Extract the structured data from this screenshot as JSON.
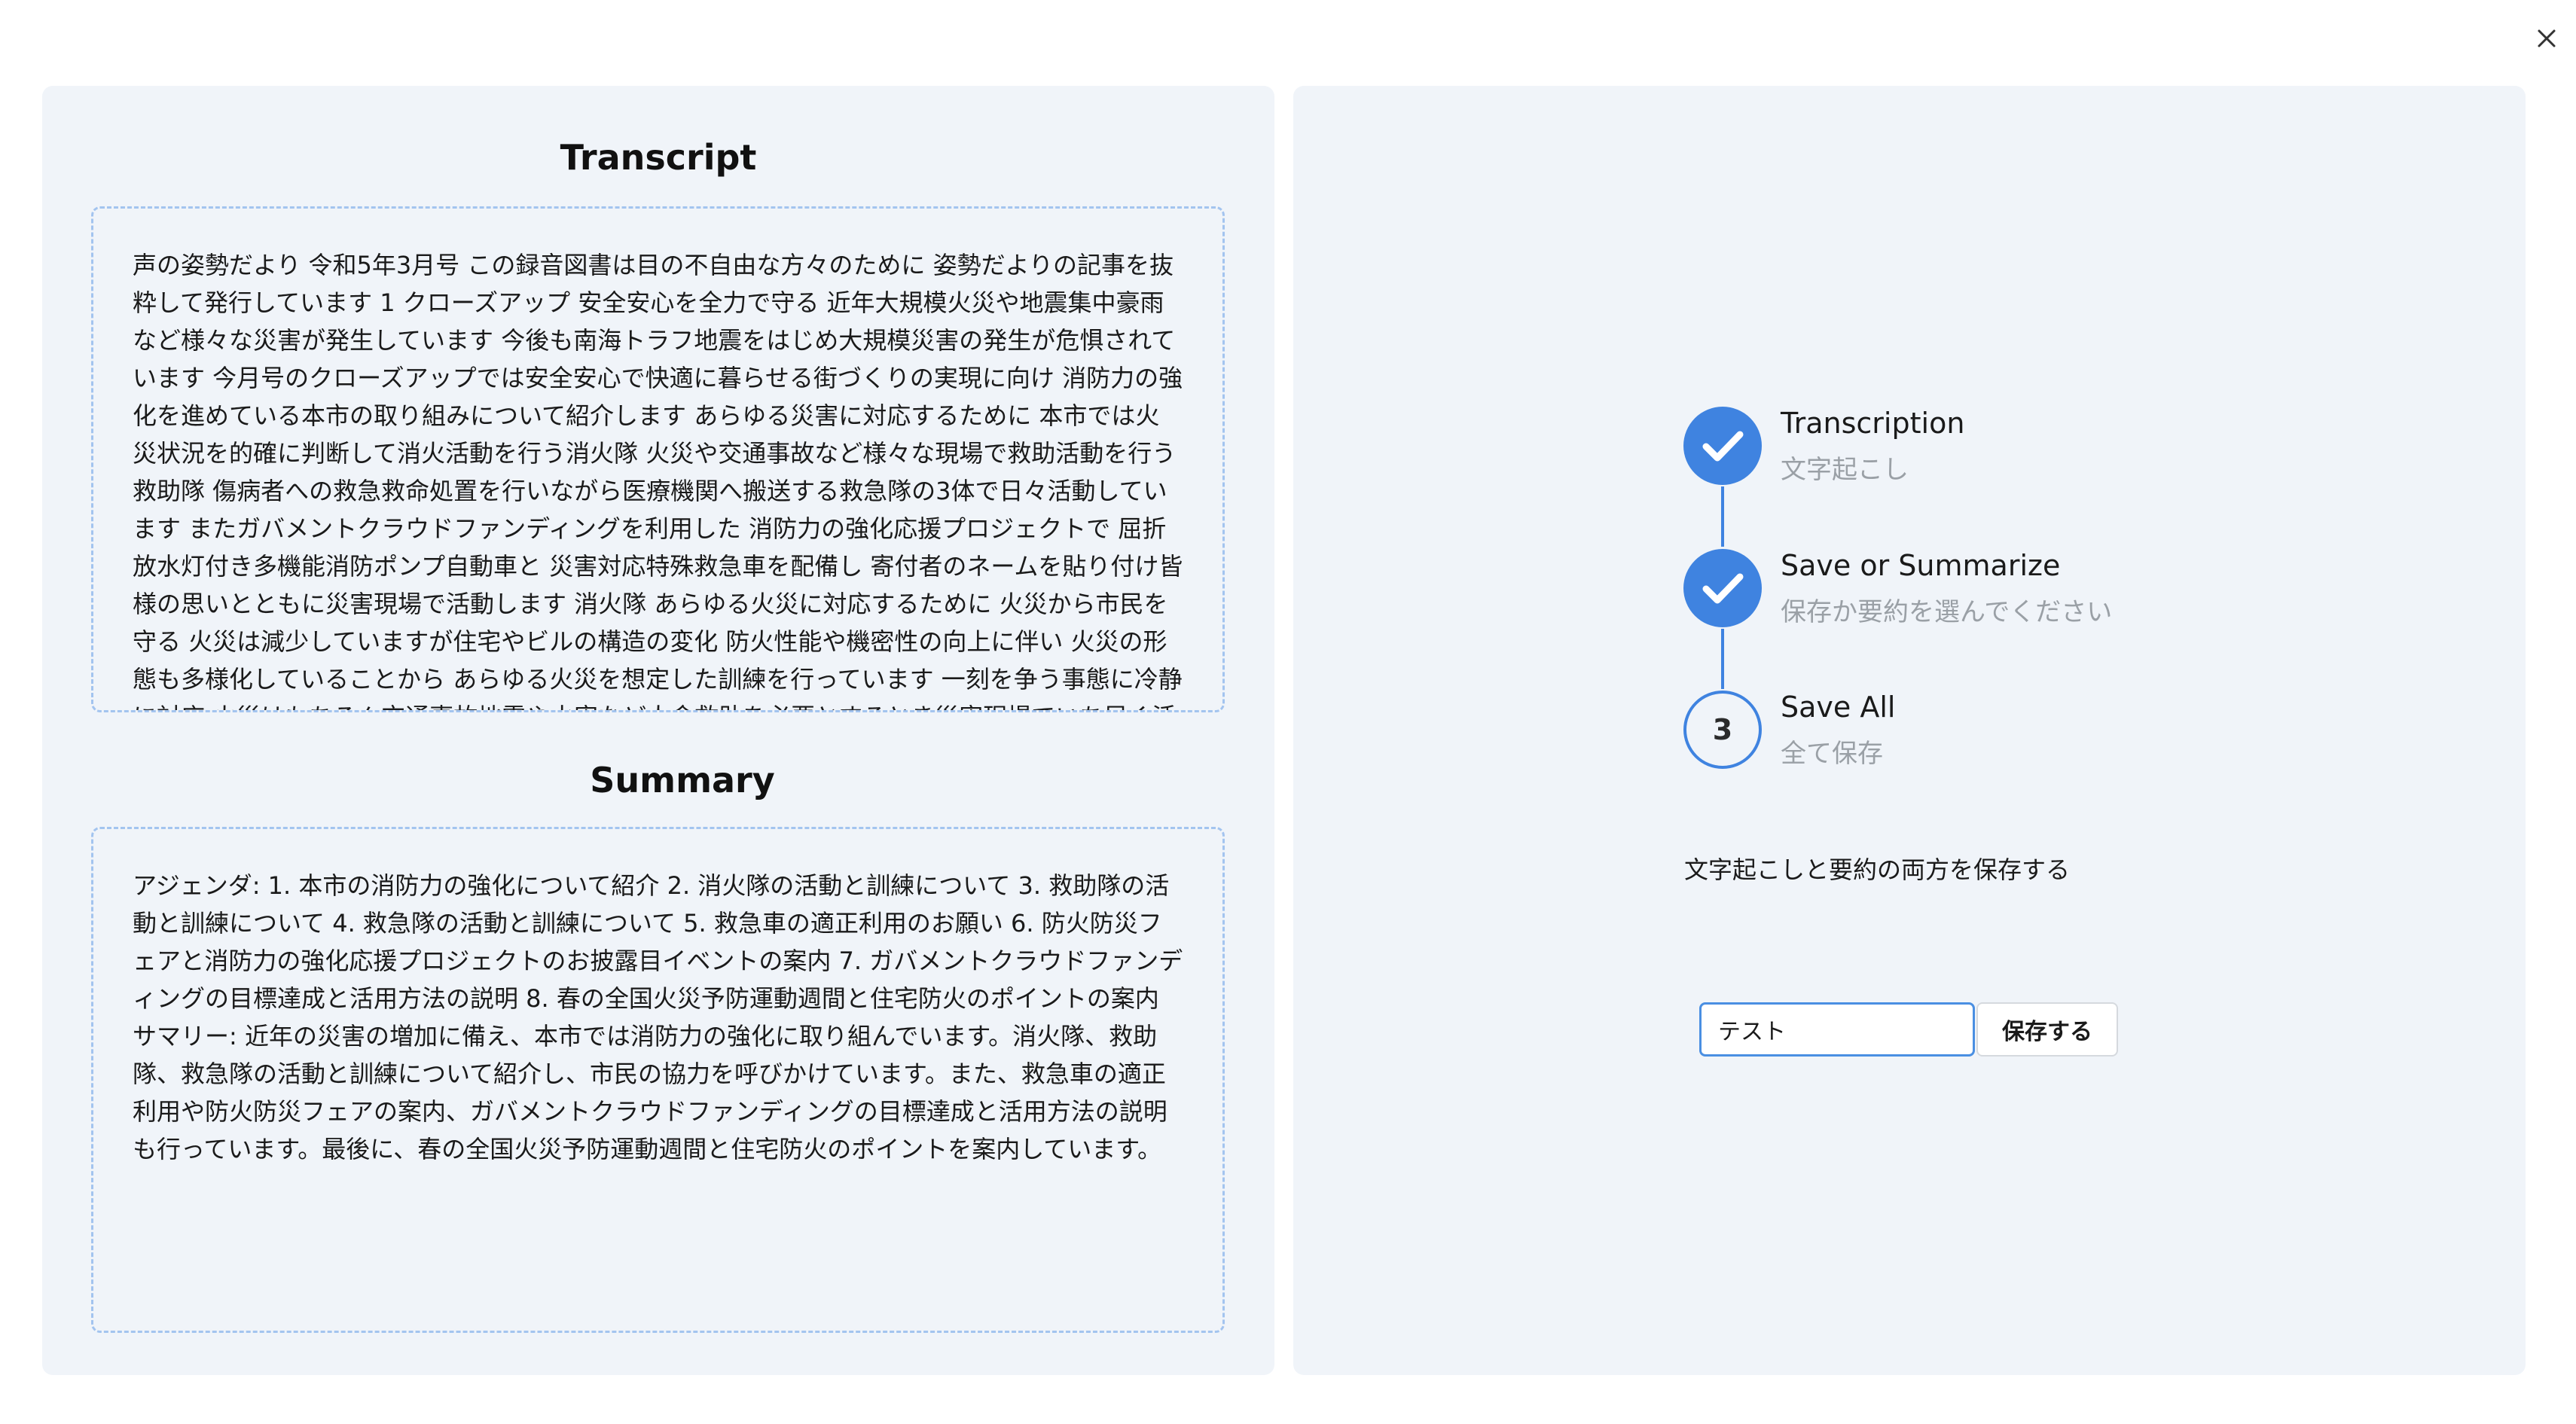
{
  "colors": {
    "accent": "#3f83e0",
    "panel_background": "#f0f4f9",
    "dashed_border": "#a3c4ef",
    "muted_text": "#9aa0a6"
  },
  "window": {
    "close_icon": "close-icon"
  },
  "transcript": {
    "title": "Transcript",
    "text": "声の姿勢だより 令和5年3月号 この録音図書は目の不自由な方々のために 姿勢だよりの記事を抜粋して発行しています 1 クローズアップ 安全安心を全力で守る 近年大規模火災や地震集中豪雨など様々な災害が発生しています 今後も南海トラフ地震をはじめ大規模災害の発生が危惧されています 今月号のクローズアップでは安全安心で快適に暮らせる街づくりの実現に向け 消防力の強化を進めている本市の取り組みについて紹介します あらゆる災害に対応するために 本市では火災状況を的確に判断して消火活動を行う消火隊 火災や交通事故など様々な現場で救助活動を行う救助隊 傷病者への救急救命処置を行いながら医療機関へ搬送する救急隊の3体で日々活動しています またガバメントクラウドファンディングを利用した 消防力の強化応援プロジェクトで 屈折放水灯付き多機能消防ポンプ自動車と 災害対応特殊救急車を配備し 寄付者のネームを貼り付け皆様の思いとともに災害現場で活動します 消火隊 あらゆる火災に対応するために 火災から市民を守る 火災は減少していますが住宅やビルの構造の変化 防火性能や機密性の向上に伴い 火災の形態も多様化していることから あらゆる火災を想定した訓練を行っています 一刻を争う事態に冷静に対応 火災はもちろん交通事故地震や水害など人命救助を必要とするとき災害現場でいち早く活動でき"
  },
  "summary": {
    "title": "Summary",
    "text": "アジェンダ: 1. 本市の消防力の強化について紹介 2. 消火隊の活動と訓練について 3. 救助隊の活動と訓練について 4. 救急隊の活動と訓練について 5. 救急車の適正利用のお願い 6. 防火防災フェアと消防力の強化応援プロジェクトのお披露目イベントの案内 7. ガバメントクラウドファンディングの目標達成と活用方法の説明 8. 春の全国火災予防運動週間と住宅防火のポイントの案内 サマリー: 近年の災害の増加に備え、本市では消防力の強化に取り組んでいます。消火隊、救助隊、救急隊の活動と訓練について紹介し、市民の協力を呼びかけています。また、救急車の適正利用や防火防災フェアの案内、ガバメントクラウドファンディングの目標達成と活用方法の説明も行っています。最後に、春の全国火災予防運動週間と住宅防火のポイントを案内しています。"
  },
  "stepper": {
    "steps": [
      {
        "title": "Transcription",
        "subtitle": "文字起こし",
        "status": "complete",
        "icon": "check-icon"
      },
      {
        "title": "Save or Summarize",
        "subtitle": "保存か要約を選んでください",
        "status": "complete",
        "icon": "check-icon"
      },
      {
        "title": "Save All",
        "subtitle": "全て保存",
        "status": "current",
        "number": "3"
      }
    ]
  },
  "save": {
    "label": "文字起こしと要約の両方を保存する",
    "input_value": "テスト",
    "button_label": "保存する"
  }
}
